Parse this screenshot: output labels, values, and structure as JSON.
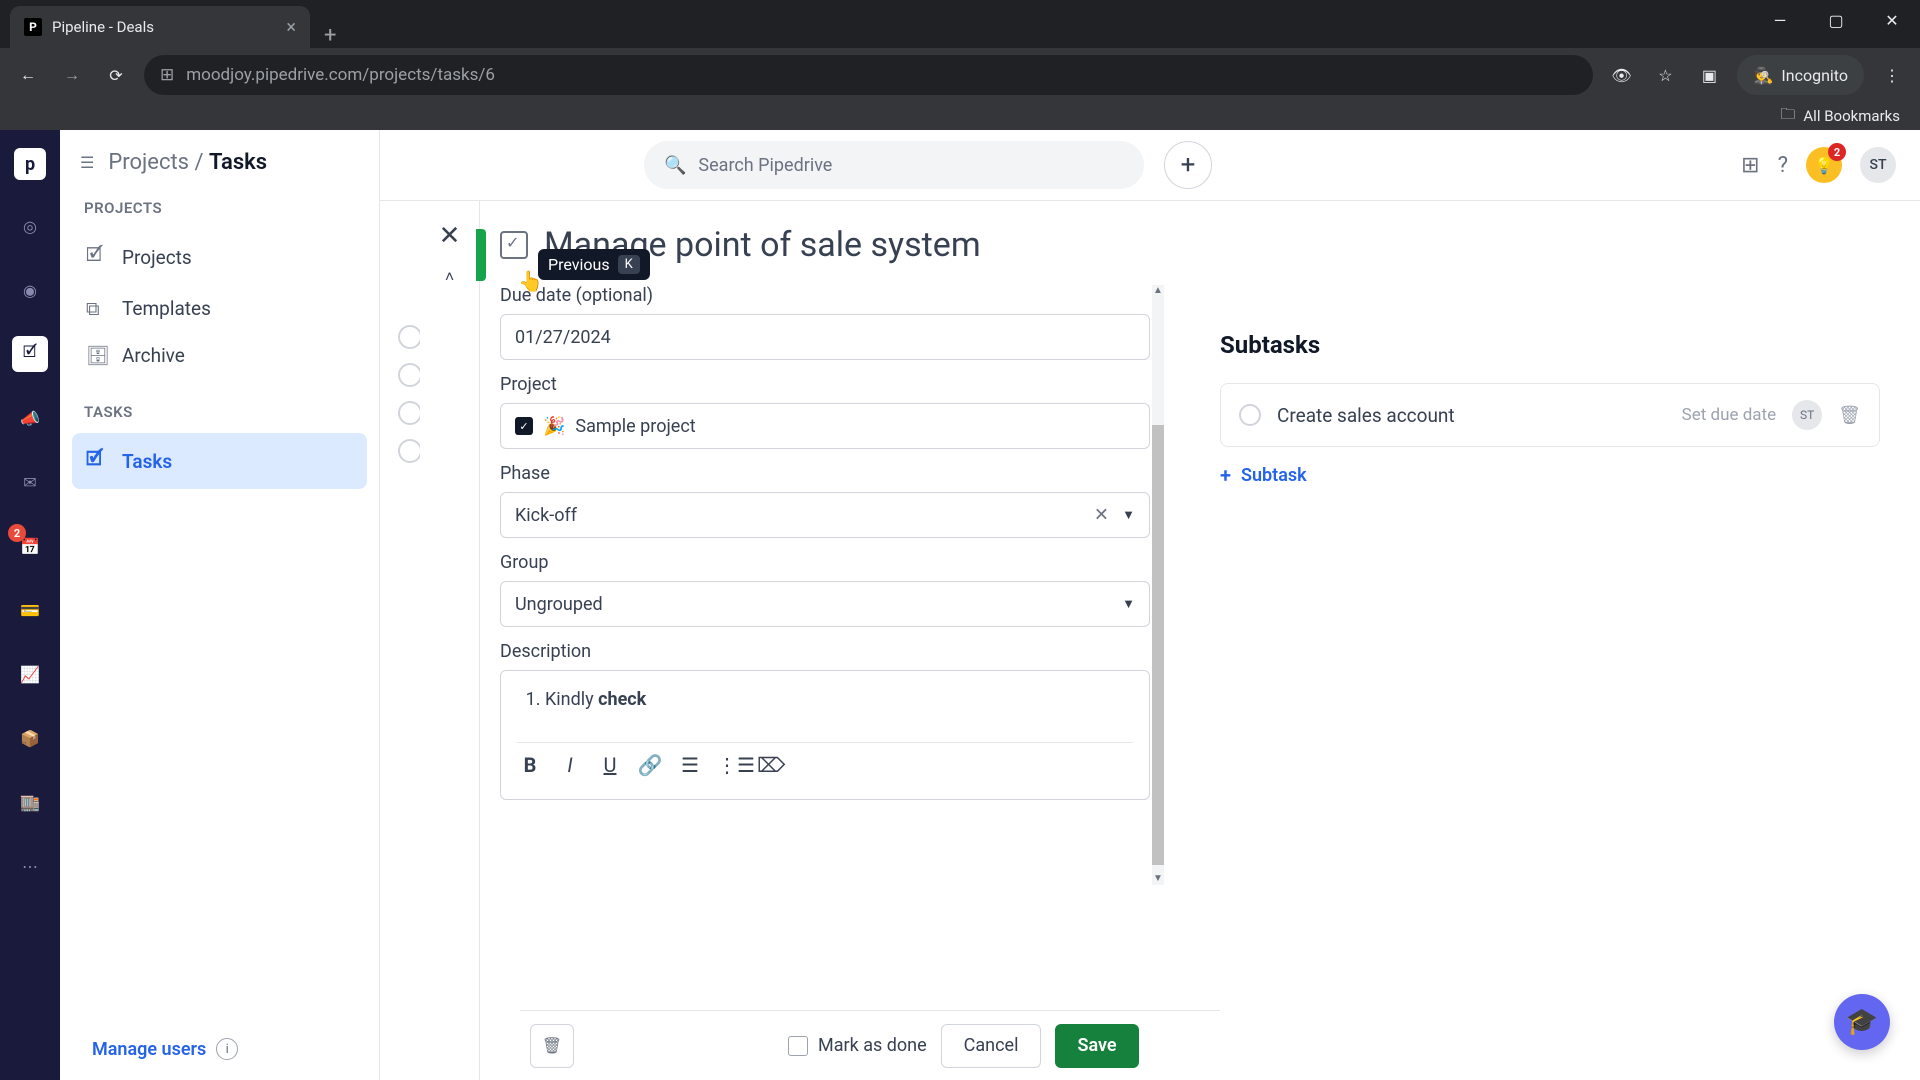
{
  "browser": {
    "tab_title": "Pipeline - Deals",
    "url": "moodjoy.pipedrive.com/projects/tasks/6",
    "incognito_label": "Incognito",
    "bookmarks_label": "All Bookmarks"
  },
  "topbar": {
    "search_placeholder": "Search Pipedrive",
    "bulb_badge": "2",
    "avatar": "ST"
  },
  "sidebar": {
    "breadcrumb_parent": "Projects",
    "breadcrumb_current": "Tasks",
    "section_projects": "PROJECTS",
    "section_tasks": "TASKS",
    "projects": "Projects",
    "templates": "Templates",
    "archive": "Archive",
    "tasks": "Tasks",
    "manage_users": "Manage users"
  },
  "rail": {
    "badge": "2"
  },
  "panel": {
    "tooltip_label": "Previous",
    "tooltip_key": "K",
    "title": "Manage point of sale system",
    "labels": {
      "due": "Due date (optional)",
      "project": "Project",
      "phase": "Phase",
      "group": "Group",
      "description": "Description"
    },
    "values": {
      "due": "01/27/2024",
      "project": "Sample project",
      "phase": "Kick-off",
      "group": "Ungrouped",
      "desc_prefix": "Kindly ",
      "desc_bold": "check"
    },
    "footer": {
      "mark_done": "Mark as done",
      "cancel": "Cancel",
      "save": "Save"
    }
  },
  "subtasks": {
    "header": "Subtasks",
    "item": {
      "title": "Create sales account",
      "due": "Set due date",
      "avatar": "ST"
    },
    "add_label": "Subtask"
  }
}
